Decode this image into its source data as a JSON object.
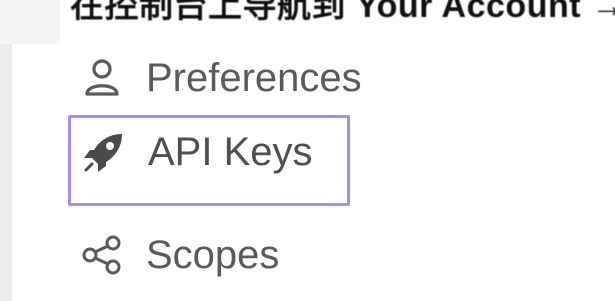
{
  "header": {
    "partial_text": "在控制台上导航到 Your Account → API Keys"
  },
  "menu": {
    "items": [
      {
        "label": "Preferences",
        "icon": "user-icon"
      },
      {
        "label": "API Keys",
        "icon": "rocket-icon",
        "highlighted": true
      },
      {
        "label": "Scopes",
        "icon": "share-nodes-icon"
      }
    ]
  },
  "colors": {
    "text": "#5a5a5a",
    "highlight": "#a78bfa"
  }
}
